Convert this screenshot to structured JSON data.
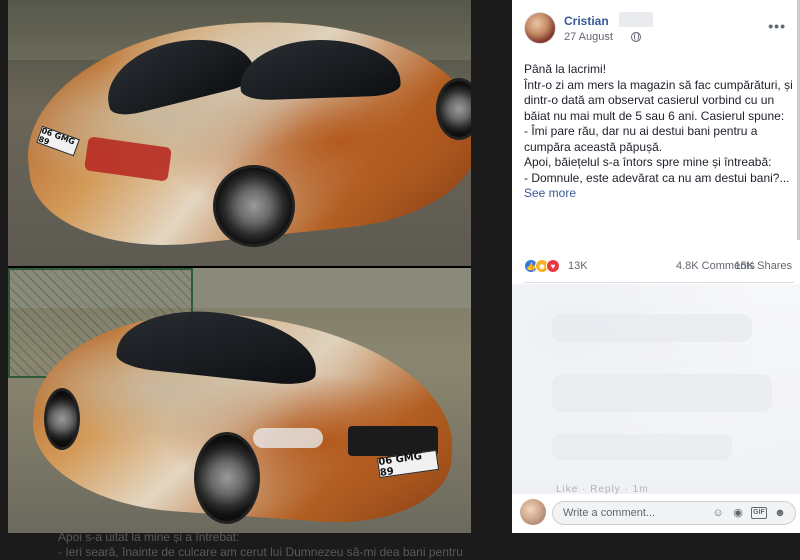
{
  "post": {
    "author": "Cristian",
    "date": "27 August",
    "more_label": "•••",
    "text_lines": [
      "Până la lacrimi!",
      "Într-o zi am mers la magazin să fac cumpărături, și dintr-o dată am observat casierul vorbind cu un băiat nu mai mult de 5 sau 6 ani. Casierul spune:",
      "- Îmi pare rău, dar nu ai destui bani pentru a cumpăra această păpușă.",
      "Apoi, băiețelul s-a întors spre mine și întreabă:",
      "- Domnule, este adevărat ca nu am destui bani?..."
    ],
    "see_more": "See more",
    "reactions_count": "13K",
    "comments_count": "4.8K Comments",
    "shares_count": "15K Shares"
  },
  "photos": {
    "top_plate": "06 GMG 89",
    "bottom_plate": "06 GMG 89"
  },
  "comment_actions": "Like · Reply · 1m",
  "comment_box": {
    "placeholder": "Write a comment...",
    "gif_label": "GIF"
  },
  "background_text": [
    "Apoi s-a uitat la mine și a întrebat:",
    "- Ieri seară, înainte de culcare am cerut lui Dumnezeu să-mi dea bani pentru"
  ]
}
